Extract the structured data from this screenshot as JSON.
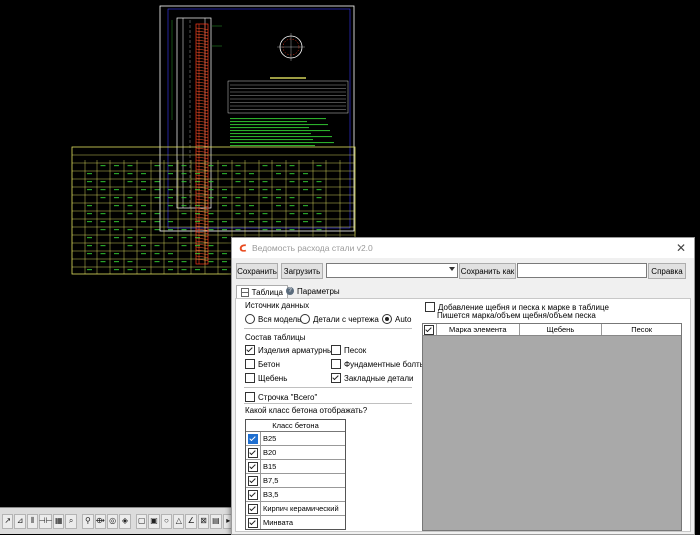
{
  "dialog": {
    "title": "Ведомость расхода стали v2.0",
    "close_glyph": "✕"
  },
  "toolbar": {
    "save_label": "Сохранить",
    "load_label": "Загрузить",
    "profile_value": "",
    "save_as_label": "Сохранить как",
    "name_value": "",
    "help_label": "Справка"
  },
  "tabs": [
    {
      "label": "Таблица",
      "icon": "table-icon",
      "active": true
    },
    {
      "label": "Параметры",
      "icon": "settings-icon",
      "active": false
    }
  ],
  "source": {
    "label": "Источник данных",
    "options": [
      {
        "label": "Вся модель",
        "checked": false
      },
      {
        "label": "Детали с чертежа",
        "checked": false
      },
      {
        "label": "Auto",
        "checked": true
      }
    ]
  },
  "composition": {
    "label": "Состав таблицы",
    "items": [
      {
        "label": "Изделия арматурные",
        "checked": true
      },
      {
        "label": "Песок",
        "checked": false
      },
      {
        "label": "Бетон",
        "checked": false
      },
      {
        "label": "Фундаментные болты",
        "checked": false
      },
      {
        "label": "Щебень",
        "checked": false
      },
      {
        "label": "Закладные детали",
        "checked": true
      }
    ]
  },
  "total_row": {
    "label": "Строчка \"Всего\"",
    "checked": false
  },
  "concrete_question": "Какой класс бетона отображать?",
  "class_table": {
    "header": "Класс бетона",
    "rows": [
      {
        "label": "B25",
        "checked": true,
        "selected": true
      },
      {
        "label": "B20",
        "checked": true,
        "selected": false
      },
      {
        "label": "B15",
        "checked": true,
        "selected": false
      },
      {
        "label": "B7,5",
        "checked": true,
        "selected": false
      },
      {
        "label": "B3,5",
        "checked": true,
        "selected": false
      },
      {
        "label": "Кирпич керамический",
        "checked": true,
        "selected": false
      },
      {
        "label": "Минвата",
        "checked": true,
        "selected": false
      }
    ]
  },
  "add_sand": {
    "checked": false,
    "label": "Добавление щебня и песка к марке в таблице",
    "hint": "Пишется марка/объем щебня/объем песка"
  },
  "grid": {
    "columns": [
      "Марка элемента",
      "Щебень",
      "Песок"
    ],
    "header_checked": true
  },
  "cad_toolbar": {
    "icons": [
      "snap-icon",
      "ortho-icon",
      "grid-icon",
      "polar-icon",
      "osnap-icon",
      "otrack-icon",
      "zoom-icon",
      "pan-icon",
      "target-icon",
      "view-icon",
      "rectangle-icon",
      "square-icon",
      "circle-icon",
      "triangle-icon",
      "angle-icon",
      "measure-icon",
      "lineweight-icon",
      "select-icon"
    ],
    "glyphs": [
      "↗",
      "⊿",
      "⫴",
      "⊣⊢",
      "▦",
      "⌕",
      "⚲",
      "⟴",
      "◎",
      "◈",
      "▢",
      "▣",
      "○",
      "△",
      "∠",
      "⊠",
      "▤",
      "▸"
    ]
  },
  "colors": {
    "cad_background": "#000000",
    "frame_white": "#ffffff",
    "frame_yellow": "#e0e060",
    "text_green": "#33cc33",
    "rebar_red": "#ff3a1a",
    "border_blue": "#3a3aff",
    "dialog_bg": "#f0f0f0",
    "selection_blue": "#1f6fd0"
  }
}
